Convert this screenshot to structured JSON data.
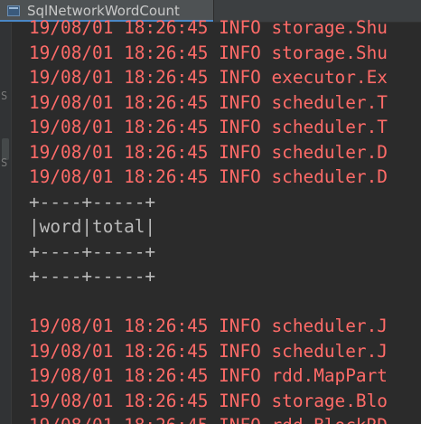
{
  "tab": {
    "title": "SqlNetworkWordCount",
    "icon": "run-config-icon"
  },
  "gutter": {
    "marks": [
      "S",
      "S"
    ]
  },
  "console": {
    "error_color": "#ff6b68",
    "output_color": "#bbbbbb",
    "lines": [
      {
        "type": "err",
        "text": "19/08/01 18:26:45 INFO storage.Shu"
      },
      {
        "type": "err",
        "text": "19/08/01 18:26:45 INFO storage.Shu"
      },
      {
        "type": "err",
        "text": "19/08/01 18:26:45 INFO executor.Ex"
      },
      {
        "type": "err",
        "text": "19/08/01 18:26:45 INFO scheduler.T"
      },
      {
        "type": "err",
        "text": "19/08/01 18:26:45 INFO scheduler.T"
      },
      {
        "type": "err",
        "text": "19/08/01 18:26:45 INFO scheduler.D"
      },
      {
        "type": "err",
        "text": "19/08/01 18:26:45 INFO scheduler.D"
      },
      {
        "type": "out",
        "text": "+----+-----+"
      },
      {
        "type": "out",
        "text": "|word|total|"
      },
      {
        "type": "out",
        "text": "+----+-----+"
      },
      {
        "type": "out",
        "text": "+----+-----+"
      },
      {
        "type": "out",
        "text": ""
      },
      {
        "type": "err",
        "text": "19/08/01 18:26:45 INFO scheduler.J"
      },
      {
        "type": "err",
        "text": "19/08/01 18:26:45 INFO scheduler.J"
      },
      {
        "type": "err",
        "text": "19/08/01 18:26:45 INFO rdd.MapPart"
      },
      {
        "type": "err",
        "text": "19/08/01 18:26:45 INFO storage.Blo"
      },
      {
        "type": "err",
        "text": "19/08/01 18:26:45 INFO rdd.BlockRD"
      }
    ]
  }
}
